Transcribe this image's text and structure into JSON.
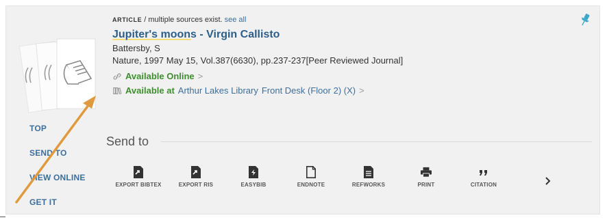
{
  "record": {
    "type": "ARTICLE",
    "sources_note": " / multiple sources exist.",
    "see_all": "see all",
    "title": "Jupiter's moons - Virgin Callisto",
    "author": "Battersby, S",
    "citation": "Nature, 1997 May 15, Vol.387(6630), pp.237-237[Peer Reviewed Journal]",
    "online_label": "Available Online",
    "online_chevron": ">",
    "library_label": "Available at",
    "library_name": "Arthur Lakes Library",
    "library_location": "Front Desk (Floor 2) (X)",
    "library_chevron": ">"
  },
  "sidenav": {
    "items": [
      "TOP",
      "SEND TO",
      "VIEW ONLINE",
      "GET IT"
    ]
  },
  "sendto": {
    "heading": "Send to",
    "actions": [
      {
        "label": "EXPORT BIBTEX",
        "icon": "export-bibtex-icon"
      },
      {
        "label": "EXPORT RIS",
        "icon": "export-ris-icon"
      },
      {
        "label": "EASYBIB",
        "icon": "easybib-icon"
      },
      {
        "label": "ENDNOTE",
        "icon": "endnote-icon"
      },
      {
        "label": "REFWORKS",
        "icon": "refworks-icon"
      },
      {
        "label": "PRINT",
        "icon": "print-icon"
      },
      {
        "label": "CITATION",
        "icon": "citation-icon"
      }
    ]
  },
  "colors": {
    "link": "#3d6e9c",
    "available": "#3e8e2f",
    "pin": "#3fa7c9",
    "highlight": "#f5d64a",
    "annotation_arrow": "#e09a3e"
  }
}
